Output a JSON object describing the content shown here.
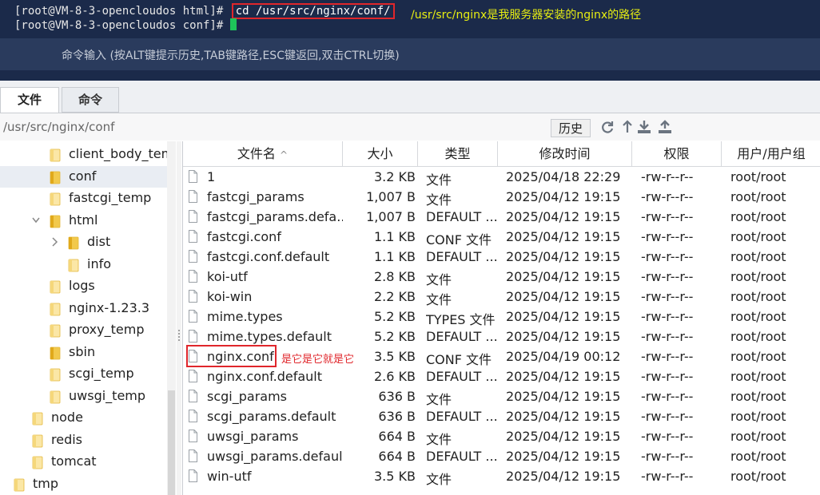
{
  "terminal": {
    "line1_prompt": "[root@VM-8-3-opencloudos html]# ",
    "line1_command": "cd /usr/src/nginx/conf/",
    "line2_prompt": "[root@VM-8-3-opencloudos conf]# ",
    "annotation": "/usr/src/nginx是我服务器安装的nginx的路径",
    "input_placeholder": "命令输入 (按ALT键提示历史,TAB键路径,ESC键返回,双击CTRL切换)"
  },
  "tabs": [
    {
      "label": "文件",
      "active": true
    },
    {
      "label": "命令",
      "active": false
    }
  ],
  "pathbar": {
    "path": "/usr/src/nginx/conf",
    "history_label": "历史",
    "icons": [
      "refresh-icon",
      "up-icon",
      "download-icon",
      "upload-icon"
    ]
  },
  "tree": [
    {
      "label": "client_body_tem",
      "selected": false
    },
    {
      "label": "conf",
      "selected": true
    },
    {
      "label": "fastcgi_temp",
      "selected": false
    },
    {
      "label": "html",
      "selected": false,
      "expanded": true
    },
    {
      "label": "dist",
      "selected": false
    },
    {
      "label": "info",
      "selected": false
    },
    {
      "label": "logs",
      "selected": false
    },
    {
      "label": "nginx-1.23.3",
      "selected": false
    },
    {
      "label": "proxy_temp",
      "selected": false
    },
    {
      "label": "sbin",
      "selected": false
    },
    {
      "label": "scgi_temp",
      "selected": false
    },
    {
      "label": "uwsgi_temp",
      "selected": false
    },
    {
      "label": "node",
      "selected": false
    },
    {
      "label": "redis",
      "selected": false
    },
    {
      "label": "tomcat",
      "selected": false
    },
    {
      "label": "tmp",
      "selected": false
    }
  ],
  "columns": {
    "name": "文件名",
    "size": "大小",
    "type": "类型",
    "modified": "修改时间",
    "perm": "权限",
    "owner": "用户/用户组"
  },
  "files": [
    {
      "name": "1",
      "size": "3.2 KB",
      "type": "文件",
      "modified": "2025/04/18 22:29",
      "perm": "-rw-r--r--",
      "owner": "root/root"
    },
    {
      "name": "fastcgi_params",
      "size": "1,007 B",
      "type": "文件",
      "modified": "2025/04/12 19:15",
      "perm": "-rw-r--r--",
      "owner": "root/root"
    },
    {
      "name": "fastcgi_params.defa...",
      "size": "1,007 B",
      "type": "DEFAULT ...",
      "modified": "2025/04/12 19:15",
      "perm": "-rw-r--r--",
      "owner": "root/root"
    },
    {
      "name": "fastcgi.conf",
      "size": "1.1 KB",
      "type": "CONF 文件",
      "modified": "2025/04/12 19:15",
      "perm": "-rw-r--r--",
      "owner": "root/root"
    },
    {
      "name": "fastcgi.conf.default",
      "size": "1.1 KB",
      "type": "DEFAULT ...",
      "modified": "2025/04/12 19:15",
      "perm": "-rw-r--r--",
      "owner": "root/root"
    },
    {
      "name": "koi-utf",
      "size": "2.8 KB",
      "type": "文件",
      "modified": "2025/04/12 19:15",
      "perm": "-rw-r--r--",
      "owner": "root/root"
    },
    {
      "name": "koi-win",
      "size": "2.2 KB",
      "type": "文件",
      "modified": "2025/04/12 19:15",
      "perm": "-rw-r--r--",
      "owner": "root/root"
    },
    {
      "name": "mime.types",
      "size": "5.2 KB",
      "type": "TYPES 文件",
      "modified": "2025/04/12 19:15",
      "perm": "-rw-r--r--",
      "owner": "root/root"
    },
    {
      "name": "mime.types.default",
      "size": "5.2 KB",
      "type": "DEFAULT ...",
      "modified": "2025/04/12 19:15",
      "perm": "-rw-r--r--",
      "owner": "root/root"
    },
    {
      "name": "nginx.conf",
      "size": "3.5 KB",
      "type": "CONF 文件",
      "modified": "2025/04/19 00:12",
      "perm": "-rw-r--r--",
      "owner": "root/root",
      "annotation": "是它是它就是它"
    },
    {
      "name": "nginx.conf.default",
      "size": "2.6 KB",
      "type": "DEFAULT ...",
      "modified": "2025/04/12 19:15",
      "perm": "-rw-r--r--",
      "owner": "root/root"
    },
    {
      "name": "scgi_params",
      "size": "636 B",
      "type": "文件",
      "modified": "2025/04/12 19:15",
      "perm": "-rw-r--r--",
      "owner": "root/root"
    },
    {
      "name": "scgi_params.default",
      "size": "636 B",
      "type": "DEFAULT ...",
      "modified": "2025/04/12 19:15",
      "perm": "-rw-r--r--",
      "owner": "root/root"
    },
    {
      "name": "uwsgi_params",
      "size": "664 B",
      "type": "文件",
      "modified": "2025/04/12 19:15",
      "perm": "-rw-r--r--",
      "owner": "root/root"
    },
    {
      "name": "uwsgi_params.default",
      "size": "664 B",
      "type": "DEFAULT ...",
      "modified": "2025/04/12 19:15",
      "perm": "-rw-r--r--",
      "owner": "root/root"
    },
    {
      "name": "win-utf",
      "size": "3.5 KB",
      "type": "文件",
      "modified": "2025/04/12 19:15",
      "perm": "-rw-r--r--",
      "owner": "root/root"
    }
  ],
  "colors": {
    "highlight": "#e0262b",
    "annotation": "#e7ee12",
    "terminal_bg": "#1b2a4a"
  }
}
